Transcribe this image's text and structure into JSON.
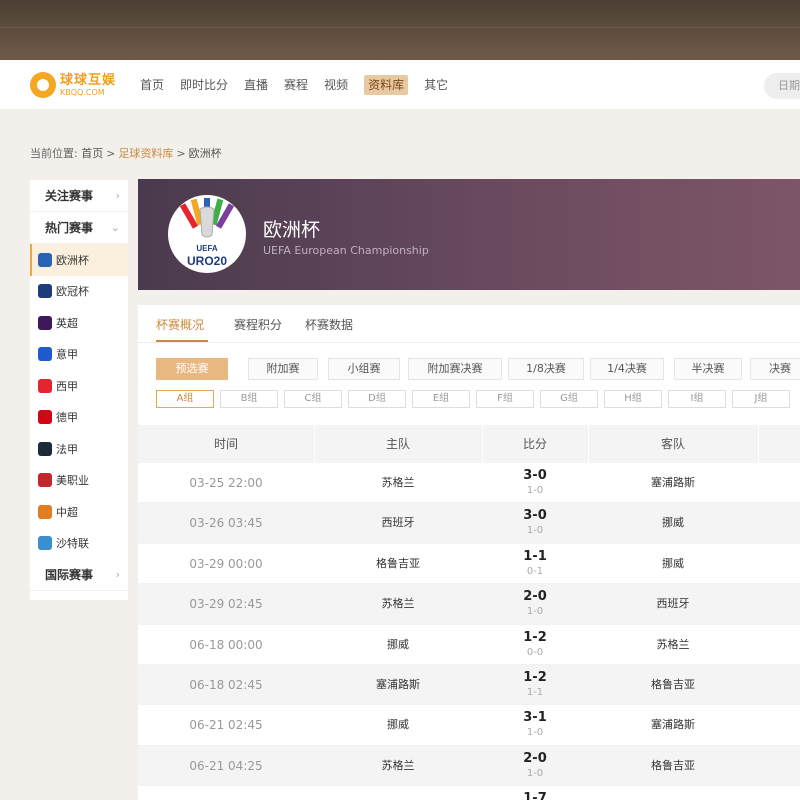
{
  "header": {
    "logo_cn": "球球互娱",
    "logo_en": "KBQQ.COM",
    "nav": [
      "首页",
      "即时比分",
      "直播",
      "赛程",
      "视频",
      "资料库",
      "其它"
    ],
    "nav_active_index": 5,
    "search_placeholder": "日期"
  },
  "breadcrumb": {
    "prefix": "当前位置:",
    "items": [
      "首页",
      "足球资料库",
      "欧洲杯"
    ],
    "separator": ">"
  },
  "sidebar": {
    "focus_label": "关注赛事",
    "hot_label": "热门赛事",
    "intl_label": "国际赛事",
    "items": [
      {
        "label": "欧洲杯",
        "icon": "euro-cup-icon",
        "color": "#2a62b5"
      },
      {
        "label": "欧冠杯",
        "icon": "ucl-icon",
        "color": "#1e3b7a"
      },
      {
        "label": "英超",
        "icon": "epl-icon",
        "color": "#3d185a"
      },
      {
        "label": "意甲",
        "icon": "serie-a-icon",
        "color": "#1e5bd1"
      },
      {
        "label": "西甲",
        "icon": "laliga-icon",
        "color": "#e4242e"
      },
      {
        "label": "德甲",
        "icon": "bundesliga-icon",
        "color": "#d20515"
      },
      {
        "label": "法甲",
        "icon": "ligue1-icon",
        "color": "#1c2a3a"
      },
      {
        "label": "美职业",
        "icon": "mls-icon",
        "color": "#c1272d"
      },
      {
        "label": "中超",
        "icon": "csl-icon",
        "color": "#e27d22"
      },
      {
        "label": "沙特联",
        "icon": "saudi-league-icon",
        "color": "#3a8fd0"
      }
    ]
  },
  "hero": {
    "title": "欧洲杯",
    "subtitle": "UEFA European Championship",
    "logo_text": "UEFA",
    "logo_year": "URO20"
  },
  "tabs": [
    "杯赛概况",
    "赛程积分",
    "杯赛数据"
  ],
  "stages": [
    "预选赛",
    "附加赛",
    "小组赛",
    "附加赛决赛",
    "1/8决赛",
    "1/4决赛",
    "半决赛",
    "决赛"
  ],
  "groups": [
    "A组",
    "B组",
    "C组",
    "D组",
    "E组",
    "F组",
    "G组",
    "H组",
    "I组",
    "J组"
  ],
  "table": {
    "headers": [
      "时间",
      "主队",
      "比分",
      "客队"
    ],
    "rows": [
      {
        "time": "03-25 22:00",
        "home": "苏格兰",
        "score": "3-0",
        "half": "1-0",
        "away": "塞浦路斯"
      },
      {
        "time": "03-26 03:45",
        "home": "西班牙",
        "score": "3-0",
        "half": "1-0",
        "away": "挪威"
      },
      {
        "time": "03-29 00:00",
        "home": "格鲁吉亚",
        "score": "1-1",
        "half": "0-1",
        "away": "挪威"
      },
      {
        "time": "03-29 02:45",
        "home": "苏格兰",
        "score": "2-0",
        "half": "1-0",
        "away": "西班牙"
      },
      {
        "time": "06-18 00:00",
        "home": "挪威",
        "score": "1-2",
        "half": "0-0",
        "away": "苏格兰"
      },
      {
        "time": "06-18 02:45",
        "home": "塞浦路斯",
        "score": "1-2",
        "half": "1-1",
        "away": "格鲁吉亚"
      },
      {
        "time": "06-21 02:45",
        "home": "挪威",
        "score": "3-1",
        "half": "1-0",
        "away": "塞浦路斯"
      },
      {
        "time": "06-21 04:25",
        "home": "苏格兰",
        "score": "2-0",
        "half": "1-0",
        "away": "格鲁吉亚"
      },
      {
        "time": "",
        "home": "",
        "score": "1-7",
        "half": "",
        "away": ""
      }
    ]
  },
  "colors": {
    "accent": "#c98a3e",
    "active_stage": "#e9b780",
    "hero_start": "#4a3a4e",
    "hero_end": "#7d5668"
  }
}
